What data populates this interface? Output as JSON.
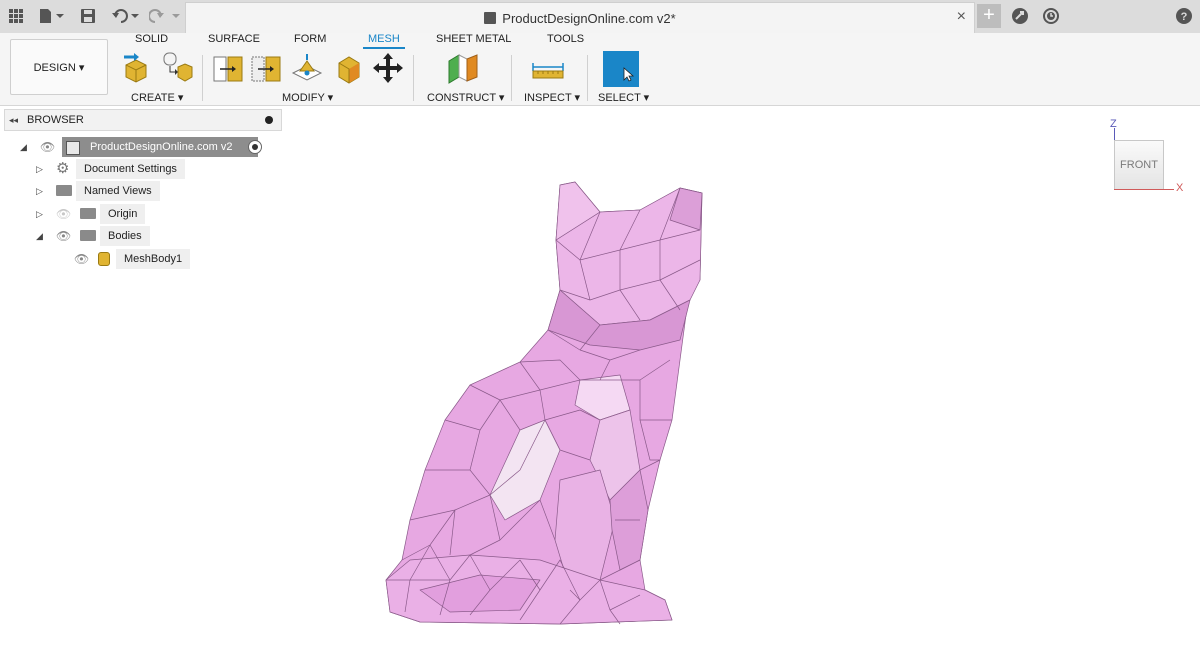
{
  "window": {
    "title": "ProductDesignOnline.com v2*",
    "close_glyph": "×",
    "plus_glyph": "+"
  },
  "titlebar_icons": [
    "grid-icon",
    "file-icon",
    "save-icon",
    "undo-icon",
    "redo-icon",
    "plus-icon",
    "extensions-icon",
    "clock-icon",
    "help-icon"
  ],
  "toolbar": {
    "workspace": "DESIGN",
    "tabs": [
      "SOLID",
      "SURFACE",
      "FORM",
      "MESH",
      "SHEET METAL",
      "TOOLS"
    ],
    "active_tab": "MESH",
    "groups": {
      "create": "CREATE",
      "modify": "MODIFY",
      "construct": "CONSTRUCT",
      "inspect": "INSPECT",
      "select": "SELECT"
    }
  },
  "browser": {
    "title": "BROWSER",
    "root": "ProductDesignOnline.com v2",
    "items": [
      {
        "label": "Document Settings",
        "icon": "gear-icon"
      },
      {
        "label": "Named Views",
        "icon": "folder-icon"
      },
      {
        "label": "Origin",
        "icon": "folder-icon"
      },
      {
        "label": "Bodies",
        "icon": "folder-icon"
      },
      {
        "label": "MeshBody1",
        "icon": "mesh-body-icon"
      }
    ]
  },
  "viewcube": {
    "face": "FRONT",
    "z_axis": "Z",
    "x_axis": "X"
  },
  "colors": {
    "accent": "#1a86c8",
    "mesh_fill": "#e7a8e2",
    "mesh_edge": "#8a5a8a",
    "select_blue": "#1a86c8"
  }
}
